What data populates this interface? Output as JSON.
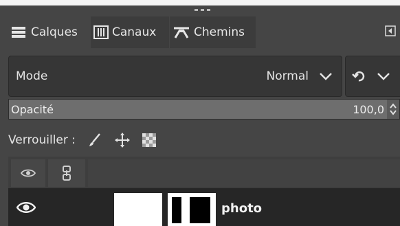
{
  "tabs": [
    {
      "label": "Calques",
      "icon": "layers-icon",
      "active": true
    },
    {
      "label": "Canaux",
      "icon": "channels-icon",
      "active": false
    },
    {
      "label": "Chemins",
      "icon": "paths-icon",
      "active": false
    }
  ],
  "mode": {
    "label": "Mode",
    "value": "Normal"
  },
  "opacity": {
    "label": "Opacité",
    "value": "100,0"
  },
  "lock": {
    "label": "Verrouiller :"
  },
  "layers": [
    {
      "name": "photo",
      "visible": true
    }
  ],
  "colors": {
    "panel": "#454545",
    "row_selected": "#262626"
  }
}
